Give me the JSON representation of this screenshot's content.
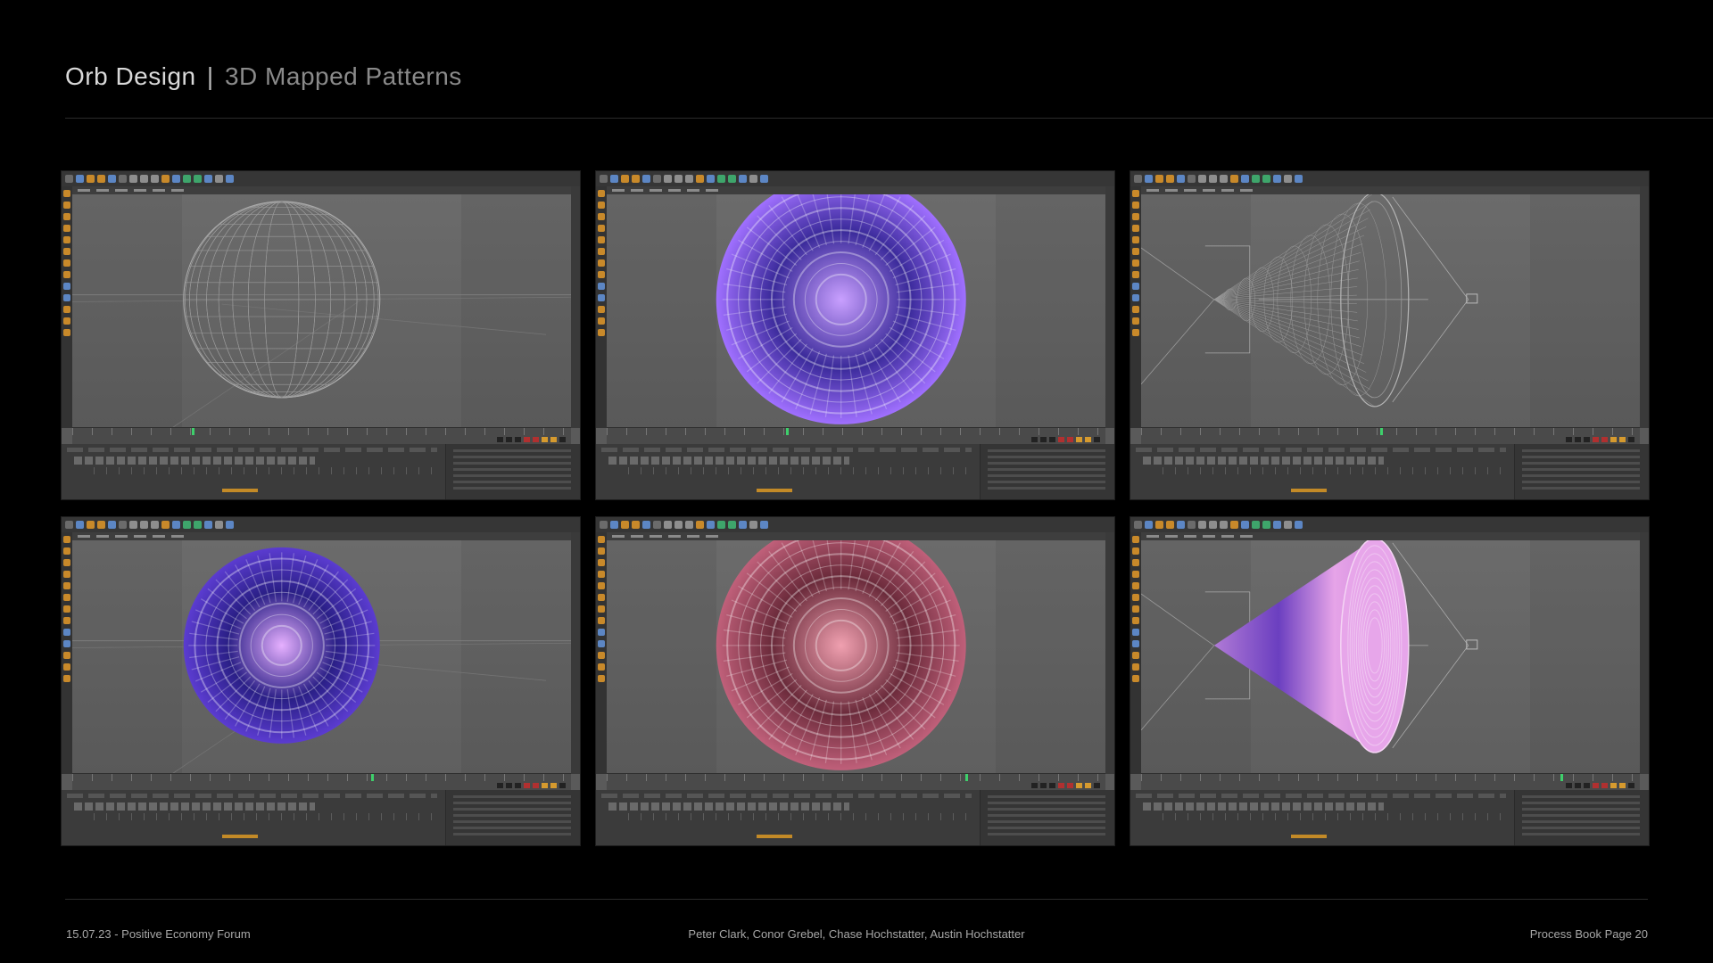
{
  "header": {
    "title_main": "Orb Design",
    "separator": "|",
    "title_sub": "3D Mapped Patterns"
  },
  "footer": {
    "date_event": "15.07.23 - Positive Economy Forum",
    "authors": "Peter Clark, Conor Grebel, Chase Hochstatter, Austin Hochstatter",
    "page_label": "Process Book Page 20"
  },
  "colors": {
    "background": "#000000",
    "viewport": "#656565",
    "purple_orb": "#8a5cf0",
    "pink_orb": "#c05a7a",
    "timeline_accent": "#c38a27",
    "playhead": "#3ecf6b"
  },
  "panels": [
    {
      "name": "wireframe-sphere",
      "kind": "wire-sphere"
    },
    {
      "name": "purple-orb-front",
      "kind": "purple-front"
    },
    {
      "name": "wireframe-cone",
      "kind": "wire-cone"
    },
    {
      "name": "purple-orb-angled",
      "kind": "purple-angled"
    },
    {
      "name": "pink-orb-front",
      "kind": "pink-front"
    },
    {
      "name": "textured-cone",
      "kind": "pink-cone"
    }
  ]
}
